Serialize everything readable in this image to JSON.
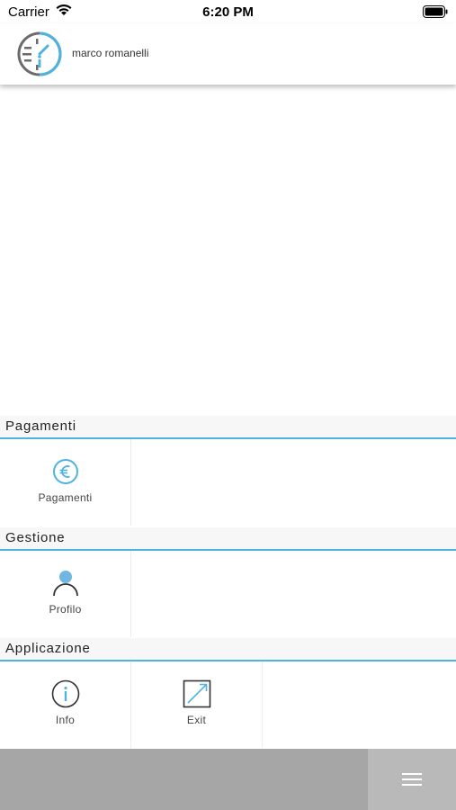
{
  "status_bar": {
    "carrier": "Carrier",
    "time": "6:20 PM"
  },
  "header": {
    "user_name": "marco romanelli",
    "logo_icon": "clock-info-logo"
  },
  "sections": [
    {
      "title": "Pagamenti",
      "tiles": [
        {
          "label": "Pagamenti",
          "icon": "euro-icon"
        }
      ]
    },
    {
      "title": "Gestione",
      "tiles": [
        {
          "label": "Profilo",
          "icon": "user-icon"
        }
      ]
    },
    {
      "title": "Applicazione",
      "tiles": [
        {
          "label": "Info",
          "icon": "info-icon"
        },
        {
          "label": "Exit",
          "icon": "exit-icon"
        }
      ]
    }
  ],
  "bottom_bar": {
    "menu_icon": "hamburger-menu-icon"
  },
  "colors": {
    "accent": "#4fb3e0",
    "logo_gray": "#6b6b6b",
    "bottom_bar": "#a6a6a6",
    "menu_button": "#b9b9b9"
  }
}
